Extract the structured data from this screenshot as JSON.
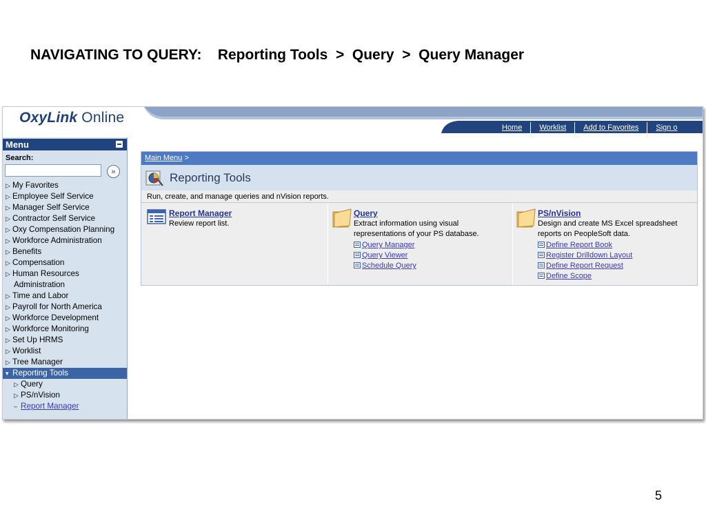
{
  "slide": {
    "title": "NAVIGATING TO QUERY:    Reporting Tools  >  Query  >  Query Manager",
    "page_number": "5"
  },
  "header": {
    "logo_brand": "OxyLink",
    "logo_suffix": " Online",
    "nav_links": [
      "Home",
      "Worklist",
      "Add to Favorites",
      "Sign o"
    ]
  },
  "sidebar": {
    "menu_title": "Menu",
    "search_label": "Search:",
    "search_value": "",
    "items": [
      {
        "label": "My Favorites"
      },
      {
        "label": "Employee Self Service"
      },
      {
        "label": "Manager Self Service"
      },
      {
        "label": "Contractor Self Service"
      },
      {
        "label": "Oxy Compensation Planning"
      },
      {
        "label": "Workforce Administration"
      },
      {
        "label": "Benefits"
      },
      {
        "label": "Compensation"
      },
      {
        "label": "Human Resources",
        "continuation": "Administration"
      },
      {
        "label": "Time and Labor"
      },
      {
        "label": "Payroll for North America"
      },
      {
        "label": "Workforce Development"
      },
      {
        "label": "Workforce Monitoring"
      },
      {
        "label": "Set Up HRMS"
      },
      {
        "label": "Worklist"
      },
      {
        "label": "Tree Manager"
      },
      {
        "label": "Reporting Tools",
        "selected": true
      }
    ],
    "sub_items": [
      "Query",
      "PS/nVision"
    ],
    "sub_link": "Report Manager"
  },
  "content": {
    "breadcrumb_link": "Main Menu",
    "breadcrumb_sep": " >",
    "title": "Reporting Tools",
    "description": "Run, create, and manage queries and nVision reports.",
    "columns": [
      {
        "title": "Report Manager",
        "text": "Review report list.",
        "links": []
      },
      {
        "title": "Query",
        "text": "Extract information using visual representations of your PS database.",
        "links": [
          "Query Manager",
          "Query Viewer",
          "Schedule Query"
        ]
      },
      {
        "title": "PS/nVision",
        "text": "Design and create MS Excel spreadsheet reports on PeopleSoft data.",
        "links": [
          "Define Report Book",
          "Register Drilldown Layout",
          "Define Report Request",
          "Define Scope"
        ]
      }
    ]
  }
}
